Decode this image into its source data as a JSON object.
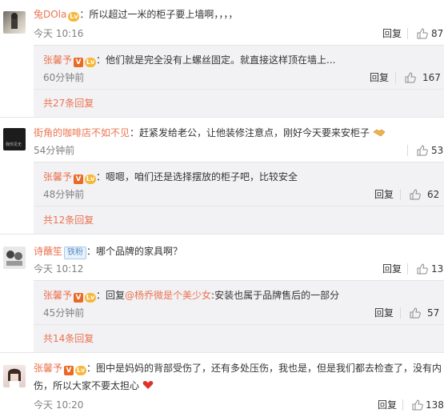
{
  "comments": [
    {
      "user": "兔DOla",
      "text": "：所以超过一米的柜子要上墙啊，，，，",
      "time": "今天 10:16",
      "reply_label": "回复",
      "likes": "87",
      "replies": [
        {
          "user": "张馨予",
          "text": "：他们就是完全没有上螺丝固定。就直接这样顶在墙上...",
          "time": "60分钟前",
          "reply_label": "回复",
          "likes": "167"
        }
      ],
      "more": "共27条回复"
    },
    {
      "user": "街角的咖啡店不如不见",
      "text": "：赶紧发给老公，让他装修注意点，刚好今天要来安柜子",
      "time": "54分钟前",
      "reply_label": "",
      "likes": "53",
      "replies": [
        {
          "user": "张馨予",
          "text": "：嗯嗯，咱们还是选择摆放的柜子吧，比较安全",
          "time": "48分钟前",
          "reply_label": "回复",
          "likes": "62"
        }
      ],
      "more": "共12条回复"
    },
    {
      "user": "诗蘸笙",
      "badge": "铁粉",
      "text": "：哪个品牌的家具啊？",
      "time": "今天 10:12",
      "reply_label": "回复",
      "likes": "13",
      "replies": [
        {
          "user": "张馨予",
          "text_prefix": "：回复",
          "mention": "@杨乔微是个美少女",
          "text": ":安装也属于品牌售后的一部分",
          "time": "45分钟前",
          "reply_label": "回复",
          "likes": "57"
        }
      ],
      "more": "共14条回复"
    },
    {
      "user": "张馨予",
      "text": "：图中是妈妈的背部受伤了，还有多处压伤，我也是，但是我们都去检查了，没有内",
      "text2": "伤，所以大家不要太担心",
      "time": "今天 10:20",
      "reply_label": "回复",
      "likes": "138"
    }
  ],
  "icons": {
    "thumb": "thumb-up-icon",
    "verified": "verified-v-icon",
    "level": "vip-level-icon",
    "heart": "red-heart-icon",
    "handshake": "handshake-icon"
  },
  "colors": {
    "username": "#eb7350",
    "reply_bg": "#f2f2f5",
    "muted": "#808080"
  }
}
